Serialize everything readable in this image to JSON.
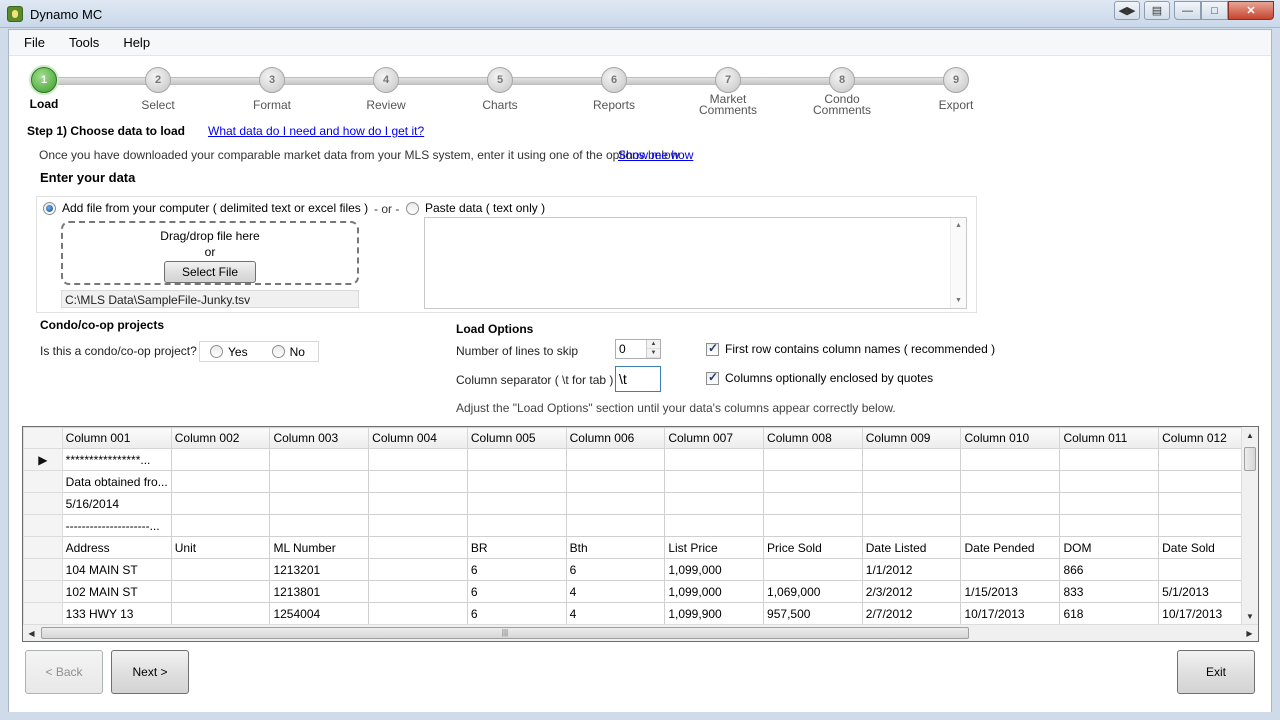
{
  "window": {
    "title": "Dynamo MC"
  },
  "menu": [
    "File",
    "Tools",
    "Help"
  ],
  "steps": [
    {
      "num": "1",
      "label": "Load"
    },
    {
      "num": "2",
      "label": "Select"
    },
    {
      "num": "3",
      "label": "Format"
    },
    {
      "num": "4",
      "label": "Review"
    },
    {
      "num": "5",
      "label": "Charts"
    },
    {
      "num": "6",
      "label": "Reports"
    },
    {
      "num": "7",
      "label": "Market\nComments"
    },
    {
      "num": "8",
      "label": "Condo\nComments"
    },
    {
      "num": "9",
      "label": "Export"
    }
  ],
  "step_heading": "Step 1) Choose data to load",
  "help_link": "What data do I need and how do I get it?",
  "intro": "Once you have downloaded your comparable market data from your MLS system, enter it using one of the options below",
  "show_link": "Show me how",
  "enter_heading": "Enter your data",
  "file_option": "Add file from your computer ( delimited text or excel files )",
  "or_text": "- or -",
  "paste_option": "Paste data ( text only )",
  "drop_text": "Drag/drop file here",
  "drop_or": "or",
  "select_file": "Select File",
  "file_path": "C:\\MLS Data\\SampleFile-Junky.tsv",
  "condo_heading": "Condo/co-op projects",
  "condo_question": "Is this a condo/co-op project?",
  "yes": "Yes",
  "no": "No",
  "load_heading": "Load Options",
  "skip_label": "Number of lines to skip",
  "skip_value": "0",
  "sep_label": "Column separator ( \\t for tab )",
  "sep_value": "\\t",
  "first_row_label": "First row contains column names ( recommended )",
  "quotes_label": "Columns optionally enclosed by quotes",
  "adjust_note": "Adjust the \"Load Options\" section until your data's columns appear correctly below.",
  "grid": {
    "columns": [
      "Column 001",
      "Column 002",
      "Column 003",
      "Column 004",
      "Column 005",
      "Column 006",
      "Column 007",
      "Column 008",
      "Column 009",
      "Column 010",
      "Column 011",
      "Column 012"
    ],
    "rows": [
      [
        "****************...",
        "",
        "",
        "",
        "",
        "",
        "",
        "",
        "",
        "",
        "",
        ""
      ],
      [
        "Data obtained fro...",
        "",
        "",
        "",
        "",
        "",
        "",
        "",
        "",
        "",
        "",
        ""
      ],
      [
        "5/16/2014",
        "",
        "",
        "",
        "",
        "",
        "",
        "",
        "",
        "",
        "",
        ""
      ],
      [
        "---------------------...",
        "",
        "",
        "",
        "",
        "",
        "",
        "",
        "",
        "",
        "",
        ""
      ],
      [
        "Address",
        "Unit",
        "ML Number",
        "",
        "BR",
        "Bth",
        "List Price",
        "Price Sold",
        "Date Listed",
        "Date Pended",
        "DOM",
        "Date Sold"
      ],
      [
        "104 MAIN ST",
        "",
        "1213201",
        "",
        "6",
        "6",
        "1,099,000",
        "",
        "1/1/2012",
        "",
        "866",
        ""
      ],
      [
        "102 MAIN ST",
        "",
        "1213801",
        "",
        "6",
        "4",
        "1,099,000",
        "1,069,000",
        "2/3/2012",
        "1/15/2013",
        "833",
        "5/1/2013"
      ],
      [
        "133 HWY 13",
        "",
        "1254004",
        "",
        "6",
        "4",
        "1,099,900",
        "957,500",
        "2/7/2012",
        "10/17/2013",
        "618",
        "10/17/2013"
      ]
    ]
  },
  "buttons": {
    "back": "< Back",
    "next": "Next >",
    "exit": "Exit"
  }
}
